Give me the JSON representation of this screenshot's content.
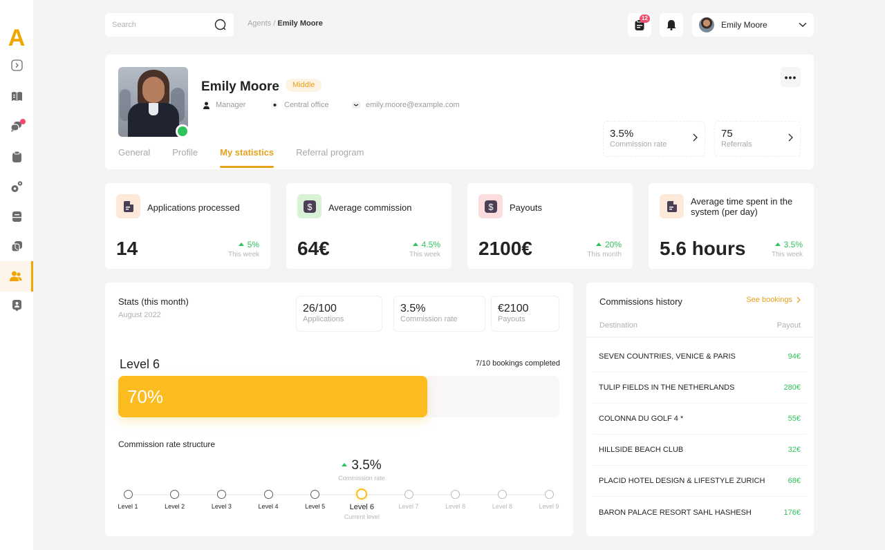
{
  "app": {
    "logo": "A"
  },
  "sidebar": {
    "items": [
      {
        "name": "expand",
        "icon": "chevron-right-box-icon"
      },
      {
        "name": "catalog",
        "icon": "book-icon"
      },
      {
        "name": "messages",
        "icon": "chat-icon",
        "badge": true
      },
      {
        "name": "tasks",
        "icon": "clipboard-icon"
      },
      {
        "name": "settings",
        "icon": "gears-icon"
      },
      {
        "name": "documents",
        "icon": "document-icon"
      },
      {
        "name": "reports",
        "icon": "pie-icon"
      },
      {
        "name": "agents",
        "icon": "users-icon",
        "active": true
      },
      {
        "name": "profile",
        "icon": "contact-icon"
      }
    ],
    "accent_color": "#f0a500"
  },
  "topbar": {
    "search_placeholder": "Search",
    "breadcrumb": {
      "parent": "Agents",
      "separator": " / ",
      "current": "Emily Moore"
    },
    "tasks_badge": "12",
    "user_name": "Emily Moore"
  },
  "profile": {
    "name": "Emily Moore",
    "level_badge": "Middle",
    "role": "Manager",
    "office": "Central office",
    "email": "emily.moore@example.com",
    "status": "online",
    "tabs": [
      {
        "label": "General",
        "active": false
      },
      {
        "label": "Profile",
        "active": false
      },
      {
        "label": "My statistics",
        "active": true
      },
      {
        "label": "Referral program",
        "active": false
      }
    ],
    "mini_stats": [
      {
        "value": "3.5%",
        "label": "Commission rate"
      },
      {
        "value": "75",
        "label": "Referrals"
      }
    ]
  },
  "kpis": [
    {
      "title": "Applications processed",
      "value": "14",
      "change": "5%",
      "period": "This week",
      "icon": "document-icon",
      "icon_bg": "#fde9d9"
    },
    {
      "title": "Average commission",
      "value": "64€",
      "change": "4.5%",
      "period": "This week",
      "icon": "dollar-icon",
      "icon_bg": "#d8f2d6"
    },
    {
      "title": "Payouts",
      "value": "2100€",
      "change": "20%",
      "period": "This month",
      "icon": "dollar-icon",
      "icon_bg": "#fcdcdc"
    },
    {
      "title": "Average time spent in the system (per day)",
      "value": "5.6 hours",
      "change": "3.5%",
      "period": "This week",
      "icon": "document-icon",
      "icon_bg": "#fde9d9"
    }
  ],
  "stats": {
    "title": "Stats (this month)",
    "subtitle": "August 2022",
    "boxes": [
      {
        "value": "26/100",
        "label": "Applications"
      },
      {
        "value": "3.5%",
        "label": "Commission rate"
      },
      {
        "value": "€2100",
        "label": "Payouts"
      }
    ],
    "level": "Level 6",
    "bookings": "7/10 bookings completed",
    "progress_percent": 70,
    "progress_label": "70%",
    "structure_title": "Commission rate structure",
    "current_rate": "3.5%",
    "current_rate_label": "Commission rate",
    "levels": [
      "Level 1",
      "Level 2",
      "Level 3",
      "Level 4",
      "Level 5",
      "Level 6",
      "Level 7",
      "Level 8",
      "Level 8",
      "Level 9"
    ],
    "current_level_index": 5,
    "current_level_caption": "Current level"
  },
  "history": {
    "title": "Commissions history",
    "link": "See bookings",
    "col_destination": "Destination",
    "col_payout": "Payout",
    "rows": [
      {
        "destination": "SEVEN COUNTRIES, VENICE & PARIS",
        "payout": "94€"
      },
      {
        "destination": "TULIP FIELDS IN THE NETHERLANDS",
        "payout": "280€"
      },
      {
        "destination": "COLONNA DU GOLF 4 *",
        "payout": "55€"
      },
      {
        "destination": "HILLSIDE BEACH CLUB",
        "payout": "32€"
      },
      {
        "destination": "PLACID HOTEL DESIGN & LIFESTYLE ZURICH",
        "payout": "68€"
      },
      {
        "destination": "BARON PALACE RESORT SAHL HASHESH",
        "payout": "176€"
      }
    ]
  }
}
